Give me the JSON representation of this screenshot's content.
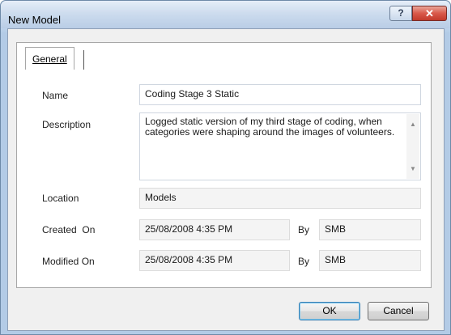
{
  "window": {
    "title": "New Model",
    "help_glyph": "?",
    "close_glyph": "✕"
  },
  "tabs": [
    {
      "label": "General",
      "active": true
    }
  ],
  "form": {
    "name": {
      "label": "Name",
      "value": "Coding Stage 3 Static"
    },
    "description": {
      "label": "Description",
      "value": "Logged static version of my third stage of coding, when categories were shaping around the images of volunteers."
    },
    "location": {
      "label": "Location",
      "value": "Models"
    },
    "created": {
      "label": "Created  On",
      "date": "25/08/2008 4:35 PM",
      "by_label": "By",
      "by": "SMB"
    },
    "modified": {
      "label": "Modified On",
      "date": "25/08/2008 4:35 PM",
      "by_label": "By",
      "by": "SMB"
    }
  },
  "buttons": {
    "ok": "OK",
    "cancel": "Cancel"
  }
}
